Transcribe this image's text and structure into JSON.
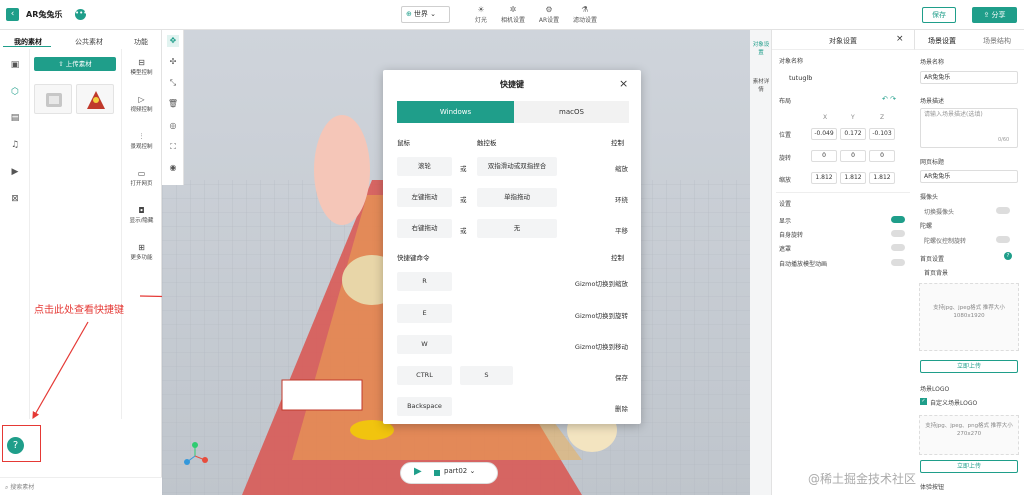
{
  "app": {
    "title": "AR兔兔乐",
    "back_icon": "‹",
    "more_icon": "•••"
  },
  "toolbar": {
    "world_select": {
      "value": "世界",
      "icon": "globe-icon"
    },
    "tools": [
      {
        "label": "灯光",
        "icon": "bulb-icon"
      },
      {
        "label": "相机设置",
        "icon": "camera-icon"
      },
      {
        "label": "AR设置",
        "icon": "gear-icon"
      },
      {
        "label": "滤动设置",
        "icon": "filter-icon"
      }
    ],
    "save_label": "保存",
    "share_label": "分享"
  },
  "left_panel": {
    "tabs": [
      "我的素材",
      "公共素材",
      "功能"
    ],
    "upload_label": "上传素材",
    "functions": [
      {
        "label": "模型控制",
        "icon": "model-icon"
      },
      {
        "label": "视频控制",
        "icon": "video-icon"
      },
      {
        "label": "景观控制",
        "icon": "sliders-icon"
      },
      {
        "label": "打开网页",
        "icon": "monitor-icon"
      },
      {
        "label": "显示/隐藏",
        "icon": "toggle-icon"
      },
      {
        "label": "更多功能",
        "icon": "grid-icon"
      }
    ],
    "search_placeholder": "搜索素材"
  },
  "annotation": {
    "text": "点击此处查看快捷键"
  },
  "viewport": {
    "part_label": "part02"
  },
  "modal": {
    "title": "快捷键",
    "close": "×",
    "tabs": [
      "Windows",
      "macOS"
    ],
    "section1": {
      "col1": "鼠标",
      "col2": "触控板",
      "col3": "控制"
    },
    "rows1": [
      {
        "mouse": "滚轮",
        "or": "或",
        "touch": "双指滑动或双指捏合",
        "action": "缩放"
      },
      {
        "mouse": "左键拖动",
        "or": "或",
        "touch": "单指拖动",
        "action": "环绕"
      },
      {
        "mouse": "右键拖动",
        "or": "或",
        "touch": "无",
        "action": "平移"
      }
    ],
    "section2": {
      "col1": "快捷键命令",
      "col3": "控制"
    },
    "rows2": [
      {
        "key": "R",
        "action": "Gizmo切换到缩放"
      },
      {
        "key": "E",
        "action": "Gizmo切换到旋转"
      },
      {
        "key": "W",
        "action": "Gizmo切换到移动"
      },
      {
        "key": "CTRL",
        "key2": "S",
        "action": "保存"
      },
      {
        "key": "Backspace",
        "action": "删除"
      }
    ]
  },
  "right_panel": {
    "vtabs": [
      "对象设置",
      "素材详情"
    ],
    "object_header": "对象设置",
    "scene_header_tabs": [
      "场景设置",
      "场景结构"
    ],
    "object": {
      "name_label": "对象名称",
      "name_value": "tutuglb",
      "layout_label": "布局",
      "axes": [
        "X",
        "Y",
        "Z"
      ],
      "position_label": "位置",
      "position": [
        "-0.049",
        "0.172",
        "-0.103"
      ],
      "rotation_label": "旋转",
      "rotation": [
        "0",
        "0",
        "0"
      ],
      "scale_label": "缩放",
      "scale": [
        "1.812",
        "1.812",
        "1.812"
      ],
      "settings_label": "设置",
      "show_label": "显示",
      "autorotate_label": "自身旋转",
      "occlusion_label": "遮罩",
      "autoplay_label": "自动播放模型动画"
    },
    "scene": {
      "name_label": "场景名称",
      "name_value": "AR兔兔乐",
      "desc_label": "场景描述",
      "desc_placeholder": "请输入场景描述(选填)",
      "desc_count": "0/60",
      "web_title_label": "网页标题",
      "web_title_value": "AR兔兔乐",
      "camera_label": "摄像头",
      "switch_camera_label": "切换摄像头",
      "gyro_label": "陀螺",
      "gyro_sub_label": "陀螺仪控制旋转",
      "home_label": "首页设置",
      "home_bg_label": "首页背景",
      "upload_hint": "支持jpg、jpeg格式 推荐大小1080x1920",
      "upload_now": "立即上传",
      "logo_label": "场景LOGO",
      "custom_logo_label": "自定义场景LOGO",
      "logo_hint": "支持jpg、jpeg、png格式 推荐大小270x270",
      "upload_now2": "立即上传",
      "tip_label": "体验按钮"
    }
  },
  "watermark": "@稀土掘金技术社区",
  "colors": {
    "accent": "#1f9e8a",
    "annotation": "#e53935"
  }
}
